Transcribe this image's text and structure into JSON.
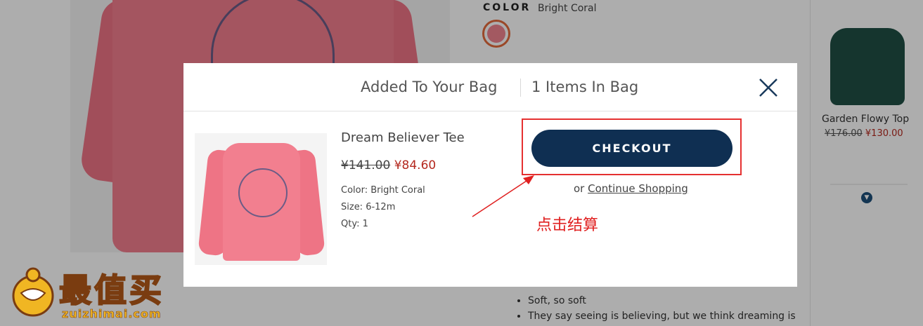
{
  "background": {
    "color_label": "COLOR",
    "color_value": "Bright Coral",
    "recommended": {
      "name": "Garden Flowy Top",
      "original_price": "¥176.00",
      "sale_price": "¥130.00"
    },
    "bullets": [
      "",
      "Soft, so soft",
      "They say seeing is believing, but we think dreaming is"
    ]
  },
  "modal": {
    "title": "Added To Your Bag",
    "count": "1 Items In Bag",
    "close_icon": "close-icon",
    "product": {
      "name": "Dream Believer Tee",
      "original_price": "¥141.00",
      "sale_price": "¥84.60",
      "color": "Color: Bright Coral",
      "size": "Size: 6-12m",
      "qty": "Qty: 1"
    },
    "checkout_label": "CHECKOUT",
    "or_text": "or",
    "continue_label": "Continue Shopping"
  },
  "annotation": {
    "text": "点击结算",
    "color": "#e02020"
  },
  "watermark": {
    "title": "最值买",
    "domain": "zuizhimai.com"
  },
  "colors": {
    "checkout_button": "#0f2f52",
    "sale_price": "#b4281e",
    "swatch": "#f0838f"
  }
}
